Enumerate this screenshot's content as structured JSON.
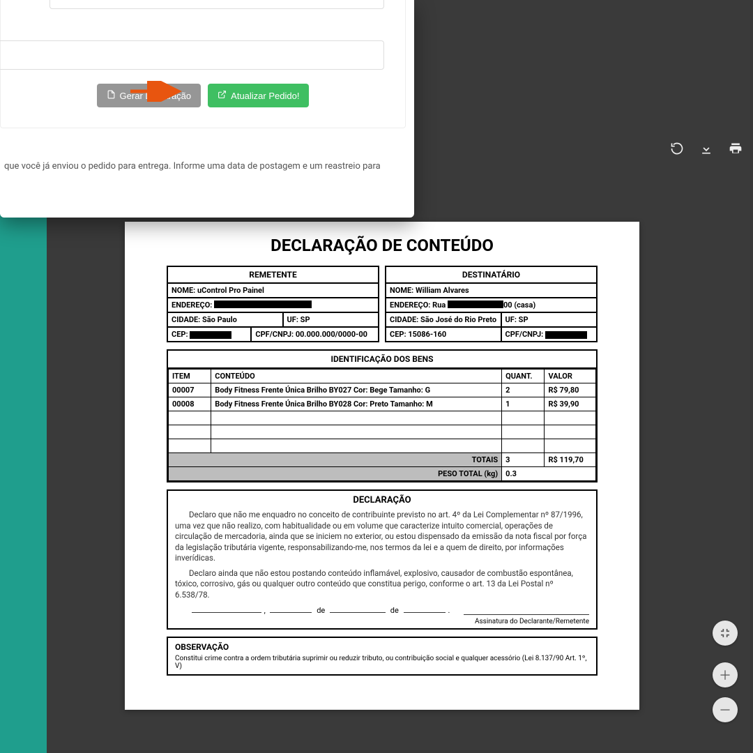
{
  "overlay": {
    "gerar_btn": "Gerar Declaração",
    "atualizar_btn": "Atualizar Pedido!",
    "info_text": " que você já enviou o pedido para entrega. Informe uma data de postagem e um reastreio para"
  },
  "doc": {
    "title": "DECLARAÇÃO DE CONTEÚDO",
    "remetente": {
      "header": "REMETENTE",
      "nome_label": "NOME:",
      "nome": "uControl Pro Painel",
      "endereco_label": "ENDEREÇO:",
      "cidade_label": "CIDADE:",
      "cidade": "São Paulo",
      "uf_label": "UF:",
      "uf": "SP",
      "cep_label": "CEP:",
      "cpf_label": "CPF/CNPJ:",
      "cpf": "00.000.000/0000-00"
    },
    "destinatario": {
      "header": "DESTINATÁRIO",
      "nome_label": "NOME:",
      "nome": "William Alvares",
      "endereco_label": "ENDEREÇO:",
      "endereco_prefix": "Rua",
      "endereco_suffix": "00 (casa)",
      "cidade_label": "CIDADE:",
      "cidade": "São José do Rio Preto",
      "uf_label": "UF:",
      "uf": "SP",
      "cep_label": "CEP:",
      "cep": "15086-160",
      "cpf_label": "CPF/CNPJ:"
    },
    "goods": {
      "header": "IDENTIFICAÇÃO DOS BENS",
      "col_item": "ITEM",
      "col_conteudo": "CONTEÚDO",
      "col_quant": "QUANT.",
      "col_valor": "VALOR",
      "rows": [
        {
          "item": "00007",
          "conteudo": "Body Fitness Frente Única Brilho BY027 Cor: Bege Tamanho: G",
          "quant": "2",
          "valor": "R$ 79,80"
        },
        {
          "item": "00008",
          "conteudo": "Body Fitness Frente Única Brilho BY028 Cor: Preto Tamanho: M",
          "quant": "1",
          "valor": "R$ 39,90"
        }
      ],
      "totais_label": "TOTAIS",
      "totais_quant": "3",
      "totais_valor": "R$ 119,70",
      "peso_label": "PESO TOTAL (kg)",
      "peso": "0.3"
    },
    "declaracao": {
      "header": "DECLARAÇÃO",
      "p1": "Declaro que não me enquadro no conceito de contribuinte previsto no art. 4º da Lei Complementar nº 87/1996, uma vez que não realizo, com habitualidade ou em volume que caracterize intuito comercial, operações de circulação de mercadoria, ainda que se iniciem no exterior, ou estou dispensado da emissão da nota fiscal por força da legislação tributária vigente, responsabilizando-me, nos termos da lei e a quem de direito, por informações inverídicas.",
      "p2": "Declaro ainda que não estou postando conteúdo inflamável, explosivo, causador de combustão espontânea, tóxico, corrosivo, gás ou qualquer outro conteúdo que constitua perigo, conforme o art. 13 da Lei Postal nº 6.538/78.",
      "de1": "de",
      "de2": "de",
      "sig": "Assinatura do Declarante/Remetente"
    },
    "observacao": {
      "header": "OBSERVAÇÃO",
      "text": "Constitui crime contra a ordem tributária suprimir ou reduzir tributo, ou contribuição social e qualquer acessório (Lei 8.137/90 Art. 1º, V)"
    }
  }
}
